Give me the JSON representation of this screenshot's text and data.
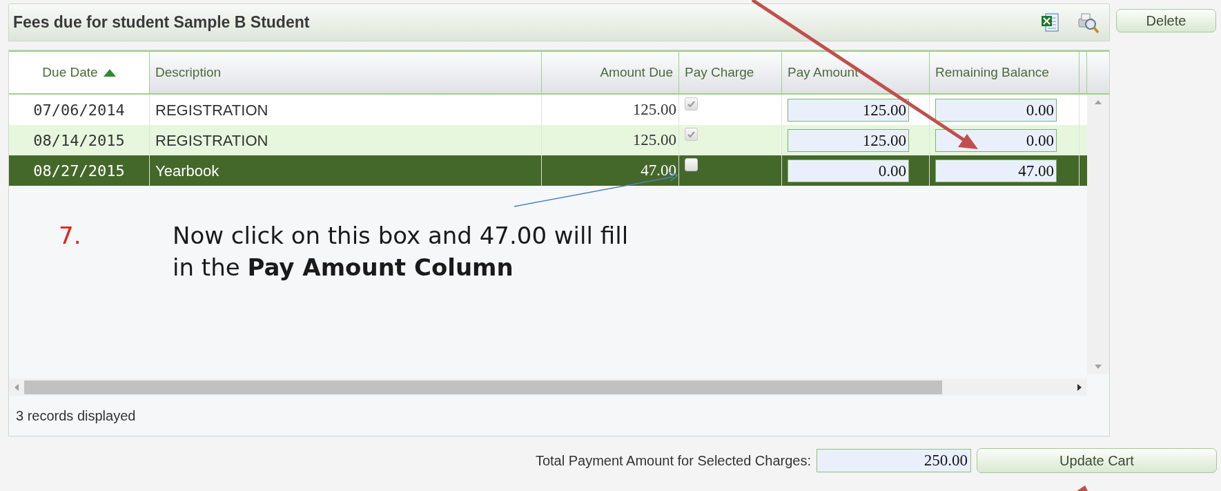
{
  "panel": {
    "title": "Fees due for student Sample B Student"
  },
  "delete_button": "Delete",
  "table": {
    "columns": [
      {
        "label": "Due Date",
        "sorted": true
      },
      {
        "label": "Description",
        "sorted": false
      },
      {
        "label": "Amount Due",
        "sorted": false
      },
      {
        "label": "Pay Charge",
        "sorted": false
      },
      {
        "label": "Pay Amount",
        "sorted": false
      },
      {
        "label": "Remaining Balance",
        "sorted": false
      }
    ],
    "rows": [
      {
        "due_date": "07/06/2014",
        "description": "REGISTRATION",
        "amount_due": "125.00",
        "pay_charge": true,
        "pay_amount": "125.00",
        "remaining_balance": "0.00",
        "selected": false
      },
      {
        "due_date": "08/14/2015",
        "description": "REGISTRATION",
        "amount_due": "125.00",
        "pay_charge": true,
        "pay_amount": "125.00",
        "remaining_balance": "0.00",
        "selected": false
      },
      {
        "due_date": "08/27/2015",
        "description": "Yearbook",
        "amount_due": "47.00",
        "pay_charge": false,
        "pay_amount": "0.00",
        "remaining_balance": "47.00",
        "selected": true
      }
    ],
    "footer": "3 records displayed"
  },
  "annotation": {
    "number": "7.",
    "text": "Now click on this box and 47.00 will fill in the **Pay Amount Column**"
  },
  "total": {
    "label": "Total Payment Amount for Selected Charges:",
    "value": "250.00"
  },
  "update_button": "Update Cart"
}
